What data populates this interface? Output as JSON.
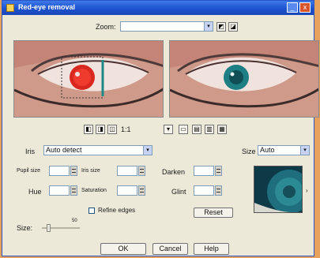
{
  "window": {
    "title": "Red-eye removal",
    "minimize": "_",
    "close": "x"
  },
  "toolbar": {
    "label": "Zoom:",
    "zoom_value": "",
    "dropdown_arrow": "▾",
    "icon1": "◩",
    "icon2": "◪"
  },
  "view_controls": {
    "b1": "◧",
    "b2": "◨",
    "b3": "◫",
    "b4": "▾",
    "b5": "▭",
    "b6": "▤",
    "b7": "▥",
    "b8": "▦",
    "zoom_label": "1:1"
  },
  "form": {
    "type_label": "Iris",
    "type_value": "Auto detect",
    "shape_label": "Size",
    "shape_value": "Auto",
    "row1": {
      "label_a": "Pupil size",
      "val_a": "",
      "label_b": "Iris size",
      "val_b": "",
      "label_c": "Darken",
      "val_c": ""
    },
    "row2": {
      "label_a": "Hue",
      "val_a": "",
      "label_b": "Saturation",
      "val_b": "",
      "label_c": "Glint",
      "val_c": ""
    },
    "checkbox_label": "Refine edges",
    "reset_button": "Reset",
    "slider_label": "Size:",
    "slider_value": "50"
  },
  "buttons": {
    "ok": "OK",
    "cancel": "Cancel",
    "help": "Help"
  }
}
